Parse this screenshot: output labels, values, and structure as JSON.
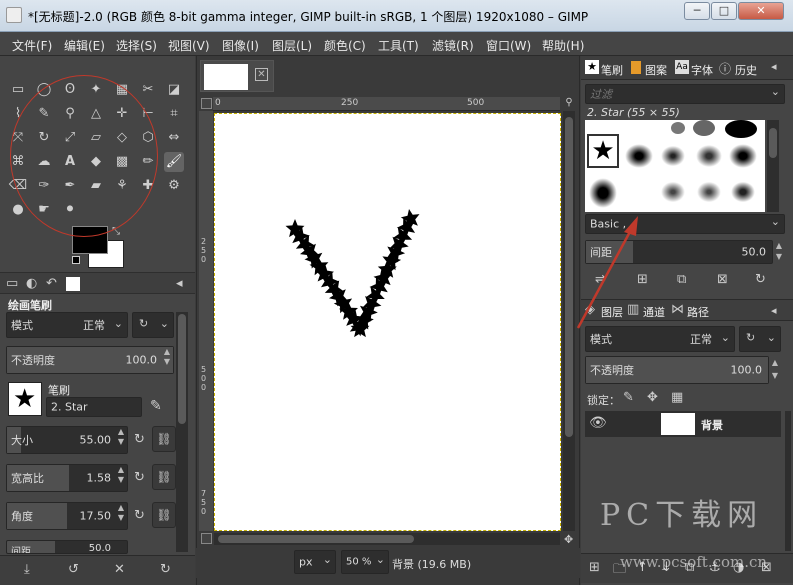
{
  "window": {
    "title": "*[无标题]-2.0 (RGB 颜色 8-bit gamma integer, GIMP built-in sRGB, 1 个图层) 1920x1080 – GIMP",
    "min_label": "─",
    "max_label": "□",
    "close_label": "✕"
  },
  "menubar": [
    "文件(F)",
    "编辑(E)",
    "选择(S)",
    "视图(V)",
    "图像(I)",
    "图层(L)",
    "颜色(C)",
    "工具(T)",
    "滤镜(R)",
    "窗口(W)",
    "帮助(H)"
  ],
  "tool_options": {
    "title": "绘画笔刷",
    "mode_label": "模式",
    "mode_value": "正常",
    "opacity_label": "不透明度",
    "opacity_value": "100.0",
    "brush_label": "笔刷",
    "brush_value": "2. Star",
    "size_label": "大小",
    "size_value": "55.00",
    "aspect_label": "宽高比",
    "aspect_value": "1.58",
    "angle_label": "角度",
    "angle_value": "17.50",
    "spacing_partial_label": "间距",
    "spacing_partial_value": "50.0"
  },
  "canvas": {
    "ruler_top": [
      "0",
      "250",
      "500"
    ],
    "ruler_left": [
      "2",
      "5",
      "0",
      "5",
      "0",
      "0",
      "7",
      "5",
      "0",
      "1",
      "0",
      "0"
    ],
    "unit": "px",
    "zoom": "50 %",
    "status": "背景 (19.6 MB)"
  },
  "brushes_panel": {
    "tabs": [
      "笔刷",
      "图案",
      "字体",
      "历史"
    ],
    "filter_placeholder": "过滤",
    "selected_brush": "2. Star (55 × 55)",
    "tag_value": "Basic ,",
    "spacing_label": "间距",
    "spacing_value": "50.0"
  },
  "layers_panel": {
    "tabs": [
      "图层",
      "通道",
      "路径"
    ],
    "mode_label": "模式",
    "mode_value": "正常",
    "opacity_label": "不透明度",
    "opacity_value": "100.0",
    "lock_label": "锁定：",
    "layer_name": "背景"
  },
  "watermark": {
    "main": "PC下载网",
    "url": "www.pcsoft.com.cn"
  },
  "colors": {
    "foreground": "#000000",
    "background": "#ffffff",
    "annotation_red": "#c0392b"
  }
}
